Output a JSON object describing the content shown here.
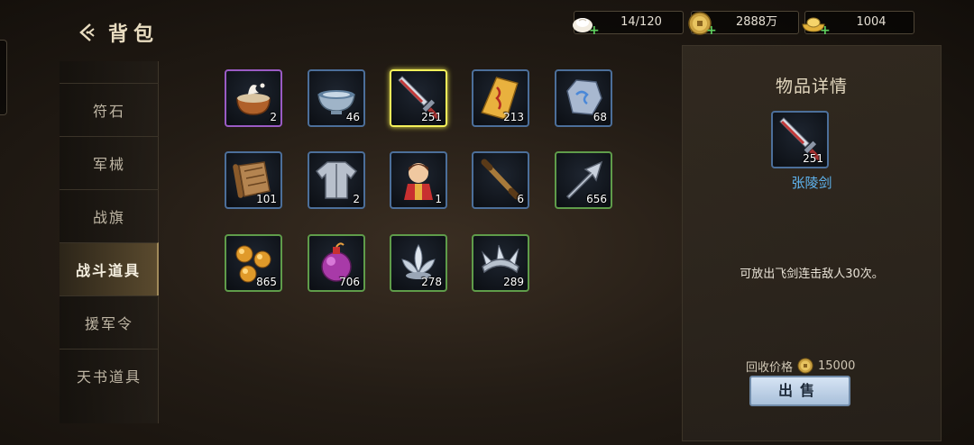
{
  "header": {
    "title": "背包"
  },
  "currencies": [
    {
      "icon": "steamed-bun-icon",
      "value": "14/120"
    },
    {
      "icon": "copper-coin-icon",
      "value": "2888万"
    },
    {
      "icon": "gold-ingot-icon",
      "value": "1004"
    }
  ],
  "tabs": [
    {
      "label": "符石",
      "active": false
    },
    {
      "label": "军械",
      "active": false
    },
    {
      "label": "战旗",
      "active": false
    },
    {
      "label": "战斗道具",
      "active": true
    },
    {
      "label": "援军令",
      "active": false
    },
    {
      "label": "天书道具",
      "active": false
    }
  ],
  "items": [
    {
      "icon": "soup-bowl-icon",
      "count": "2",
      "rarity": "purple"
    },
    {
      "icon": "porcelain-bowl-icon",
      "count": "46",
      "rarity": "blue"
    },
    {
      "icon": "flying-sword-icon",
      "count": "251",
      "rarity": "selected"
    },
    {
      "icon": "talisman-icon",
      "count": "213",
      "rarity": "blue"
    },
    {
      "icon": "jade-stone-icon",
      "count": "68",
      "rarity": "blue"
    },
    {
      "icon": "scroll-icon",
      "count": "101",
      "rarity": "blue"
    },
    {
      "icon": "armor-robe-icon",
      "count": "2",
      "rarity": "blue"
    },
    {
      "icon": "doll-icon",
      "count": "1",
      "rarity": "blue"
    },
    {
      "icon": "staff-icon",
      "count": "6",
      "rarity": "blue"
    },
    {
      "icon": "arrowhead-icon",
      "count": "656",
      "rarity": "green"
    },
    {
      "icon": "golden-pellets-icon",
      "count": "865",
      "rarity": "green"
    },
    {
      "icon": "poison-bomb-icon",
      "count": "706",
      "rarity": "green"
    },
    {
      "icon": "silver-lotus-icon",
      "count": "278",
      "rarity": "green"
    },
    {
      "icon": "spiked-ring-icon",
      "count": "289",
      "rarity": "green"
    }
  ],
  "detail": {
    "title": "物品详情",
    "icon": "flying-sword-icon",
    "count": "251",
    "name": "张陵剑",
    "description": "可放出飞剑连击敌人30次。",
    "recycle_label": "回收价格",
    "recycle_price": "15000",
    "sell_label": "出售"
  },
  "colors": {
    "selected_border": "#f4f05a",
    "blue_border": "#4c6f9a",
    "green_border": "#5f9c4a",
    "purple_border": "#9a5bc4",
    "item_name": "#5fb4f0"
  }
}
